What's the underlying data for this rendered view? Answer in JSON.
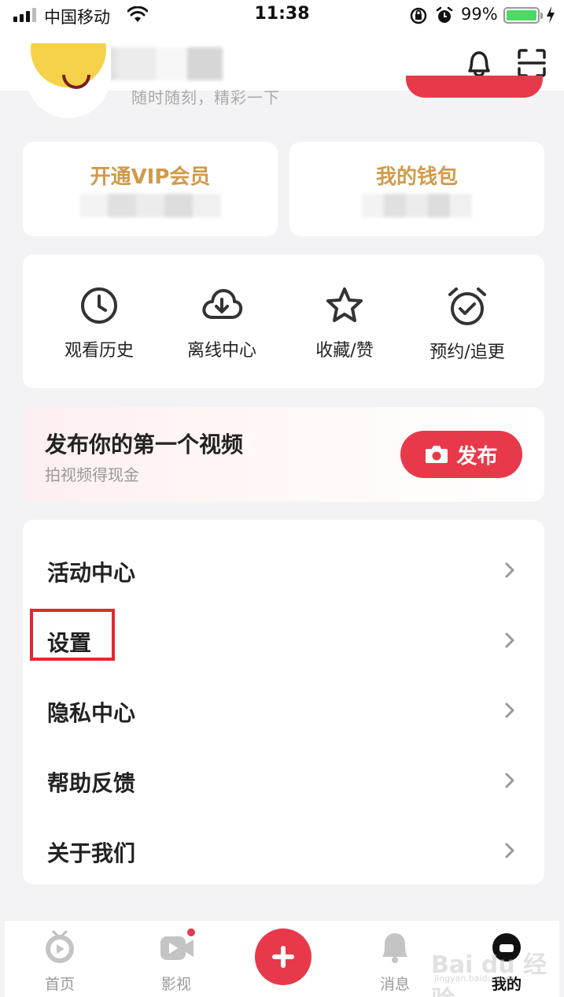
{
  "status_bar": {
    "carrier": "中国移动",
    "time": "11:38",
    "battery_percent": "99%",
    "battery_level": 0.99,
    "icons": [
      "signal-icon",
      "wifi-icon",
      "rotation-lock-icon",
      "alarm-icon",
      "battery-icon",
      "charging-icon"
    ]
  },
  "header": {
    "icons": [
      "bell-icon",
      "scan-icon"
    ]
  },
  "profile": {
    "subtitle": "随时随刻，精彩一下"
  },
  "cards": {
    "vip_title": "开通VIP会员",
    "wallet_title": "我的钱包"
  },
  "tools": [
    {
      "label": "观看历史",
      "icon": "clock-icon"
    },
    {
      "label": "离线中心",
      "icon": "cloud-download-icon"
    },
    {
      "label": "收藏/赞",
      "icon": "star-icon"
    },
    {
      "label": "预约/追更",
      "icon": "alarm-check-icon"
    }
  ],
  "publish": {
    "title": "发布你的第一个视频",
    "subtitle": "拍视频得现金",
    "button_label": "发布",
    "colors": {
      "accent": "#e8394a"
    }
  },
  "menu": [
    {
      "label": "活动中心"
    },
    {
      "label": "设置"
    },
    {
      "label": "隐私中心"
    },
    {
      "label": "帮助反馈"
    },
    {
      "label": "关于我们"
    }
  ],
  "bottom_nav": [
    {
      "label": "首页",
      "icon": "home-play-icon"
    },
    {
      "label": "影视",
      "icon": "video-icon"
    },
    {
      "label": "",
      "icon": "plus-icon"
    },
    {
      "label": "消息",
      "icon": "message-icon"
    },
    {
      "label": "我的",
      "icon": "profile-icon",
      "active": true
    }
  ],
  "watermark": {
    "text": "Bai du 经验",
    "sub": "jingyan.baidu.com"
  }
}
